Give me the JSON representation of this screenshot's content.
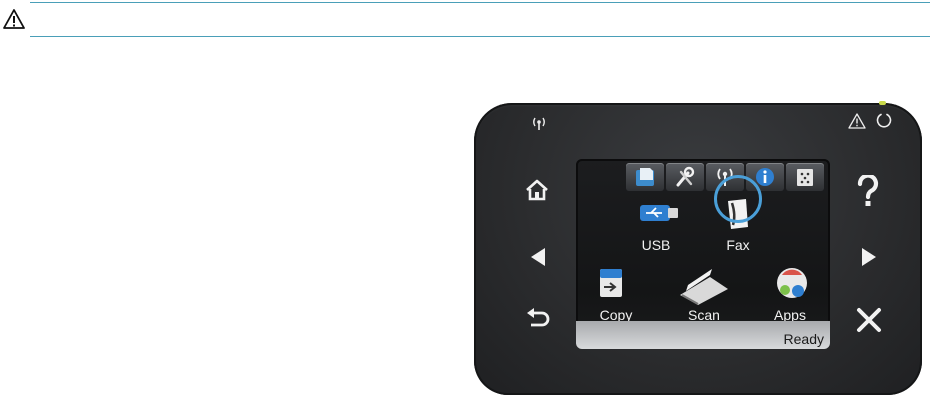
{
  "caution": {
    "icon": "warning-triangle-icon"
  },
  "panel": {
    "indicators": {
      "left": "wireless-icon",
      "right": [
        "attention-icon",
        "power-icon"
      ]
    },
    "left_buttons": [
      "home-button",
      "back-arrow-button",
      "return-button"
    ],
    "right_buttons": [
      "help-button",
      "forward-arrow-button",
      "cancel-button"
    ]
  },
  "screen": {
    "top_icons": [
      "setup-icon",
      "service-icon",
      "wireless-icon",
      "info-icon",
      "supplies-icon"
    ],
    "apps": [
      {
        "label": "USB",
        "icon": "usb-icon"
      },
      {
        "label": "Fax",
        "icon": "fax-icon"
      },
      {
        "label": "Copy",
        "icon": "copy-icon"
      },
      {
        "label": "Scan",
        "icon": "scan-icon"
      },
      {
        "label": "Apps",
        "icon": "apps-icon"
      }
    ],
    "selected": "Fax",
    "status_text": "Ready"
  },
  "colors": {
    "accent": "#4a9fd8",
    "panel": "#2a2b2d",
    "led": "#c9d94a"
  }
}
